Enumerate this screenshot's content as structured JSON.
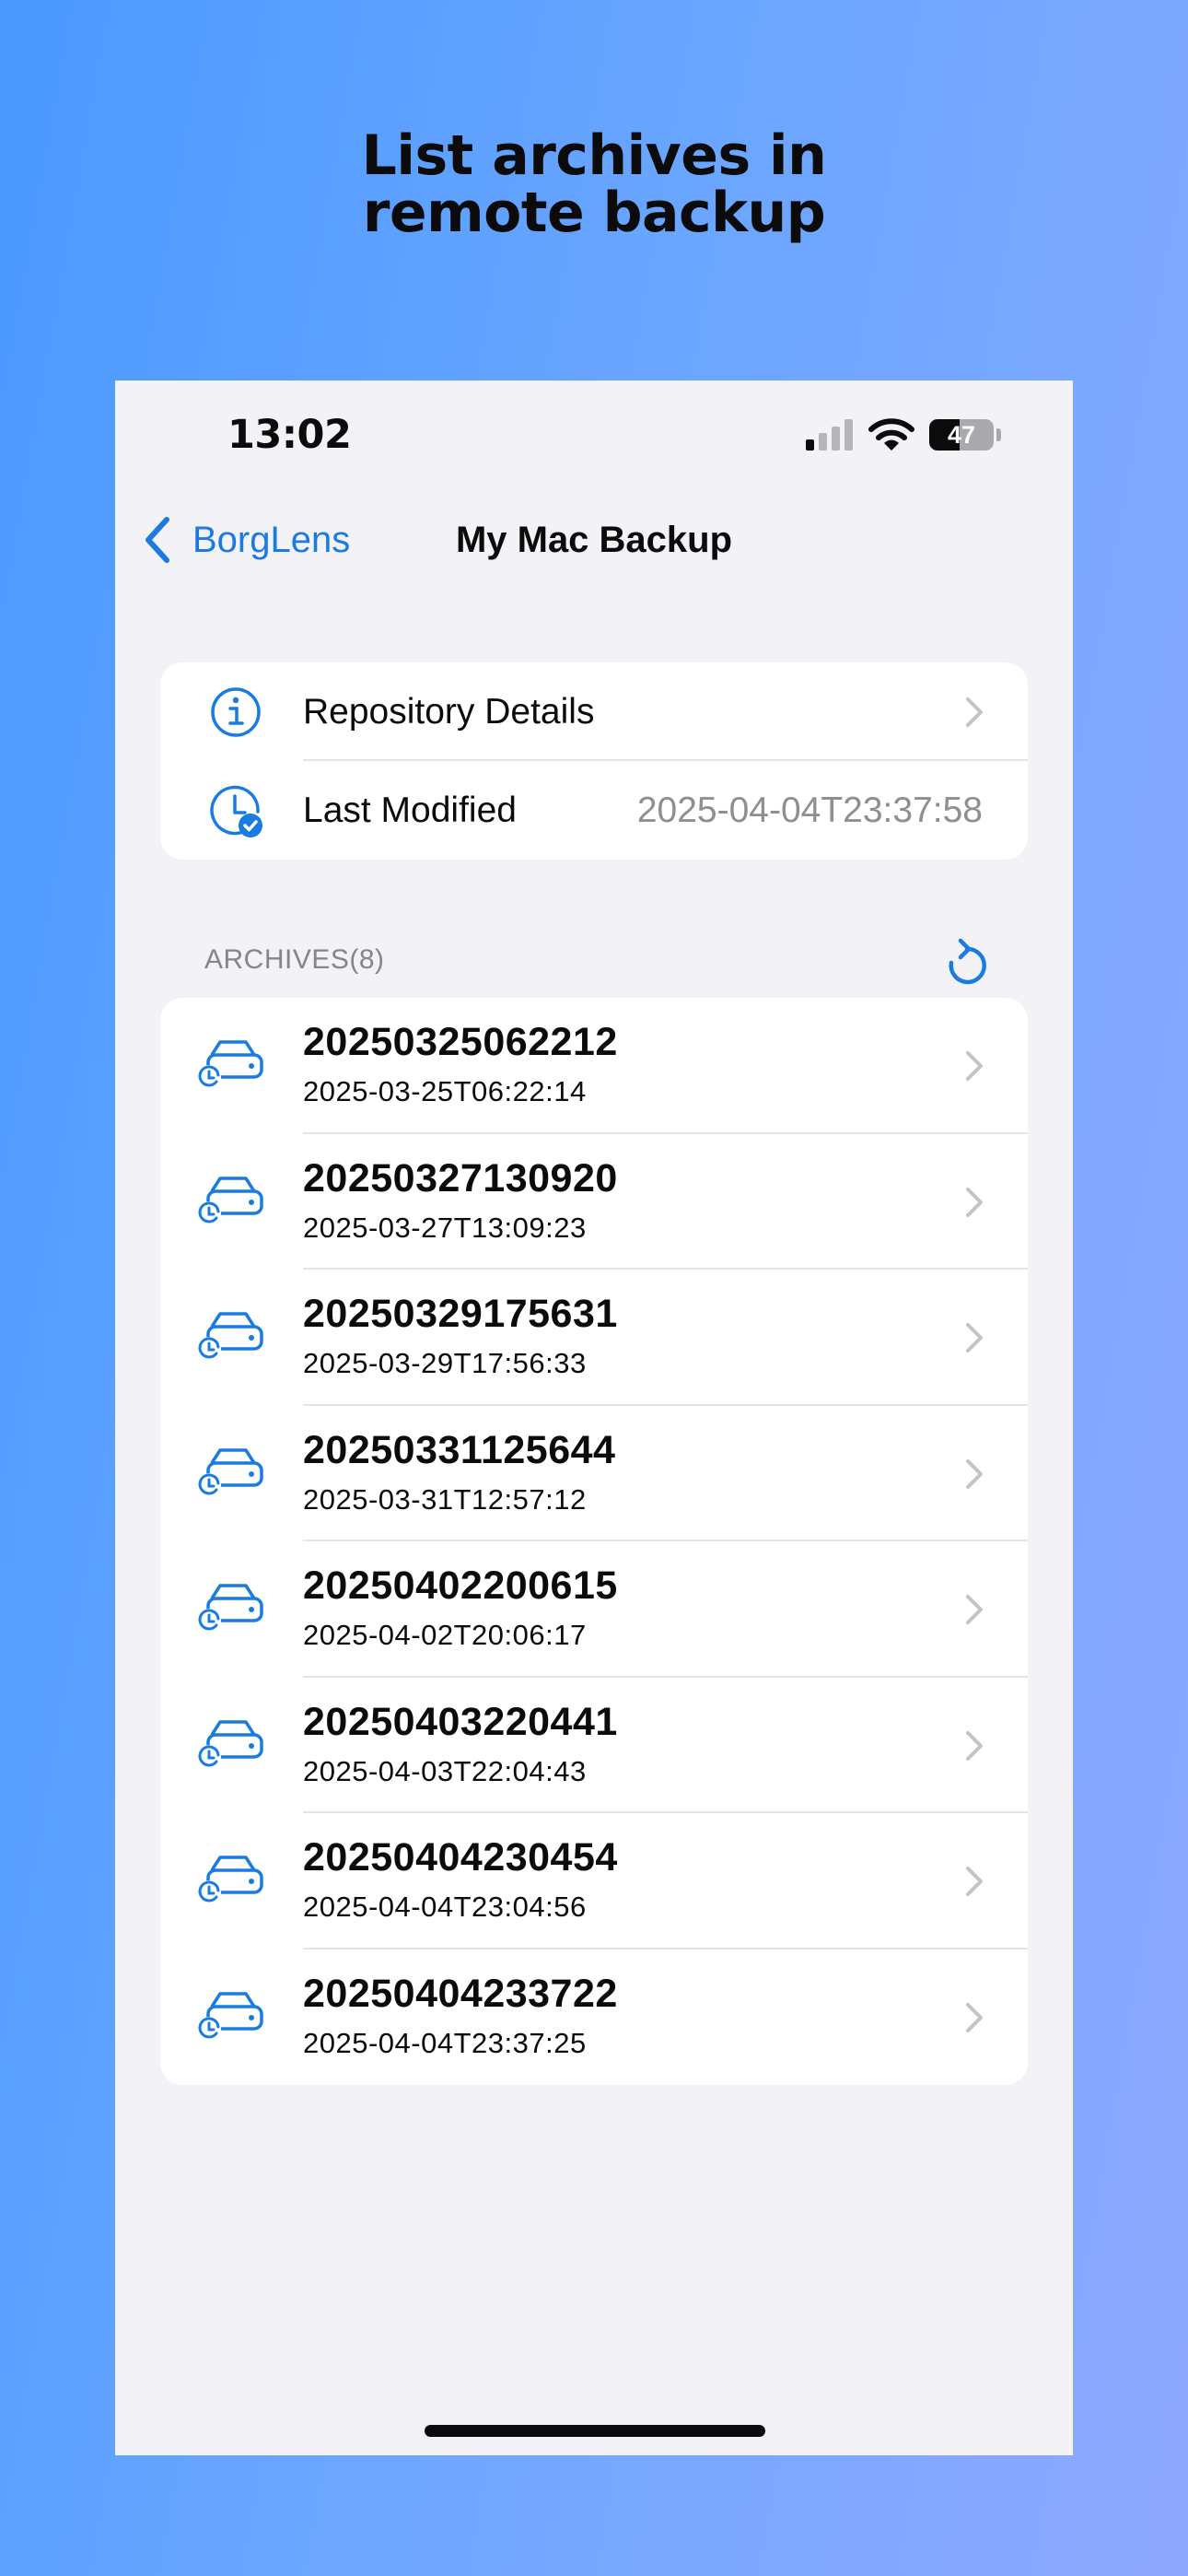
{
  "headline": {
    "line1": "List archives in",
    "line2": "remote backup"
  },
  "status_bar": {
    "time": "13:02",
    "battery": "47"
  },
  "nav": {
    "back_label": "BorgLens",
    "title": "My Mac Backup"
  },
  "details": {
    "repository_label": "Repository Details",
    "last_modified_label": "Last Modified",
    "last_modified_value": "2025-04-04T23:37:58"
  },
  "archives_header": "ARCHIVES(8)",
  "archives": [
    {
      "name": "20250325062212",
      "date": "2025-03-25T06:22:14"
    },
    {
      "name": "20250327130920",
      "date": "2025-03-27T13:09:23"
    },
    {
      "name": "20250329175631",
      "date": "2025-03-29T17:56:33"
    },
    {
      "name": "20250331125644",
      "date": "2025-03-31T12:57:12"
    },
    {
      "name": "20250402200615",
      "date": "2025-04-02T20:06:17"
    },
    {
      "name": "20250403220441",
      "date": "2025-04-03T22:04:43"
    },
    {
      "name": "20250404230454",
      "date": "2025-04-04T23:04:56"
    },
    {
      "name": "20250404233722",
      "date": "2025-04-04T23:37:25"
    }
  ],
  "colors": {
    "accent": "#1a7be0",
    "background": "#f2f2f7",
    "secondary_text": "#8e8e93"
  },
  "icons": {
    "back": "chevron-left-icon",
    "info": "info-circle-icon",
    "last_modified": "clock-checkmark-icon",
    "refresh": "refresh-icon",
    "archive": "drive-history-icon",
    "disclosure": "chevron-right-icon"
  }
}
